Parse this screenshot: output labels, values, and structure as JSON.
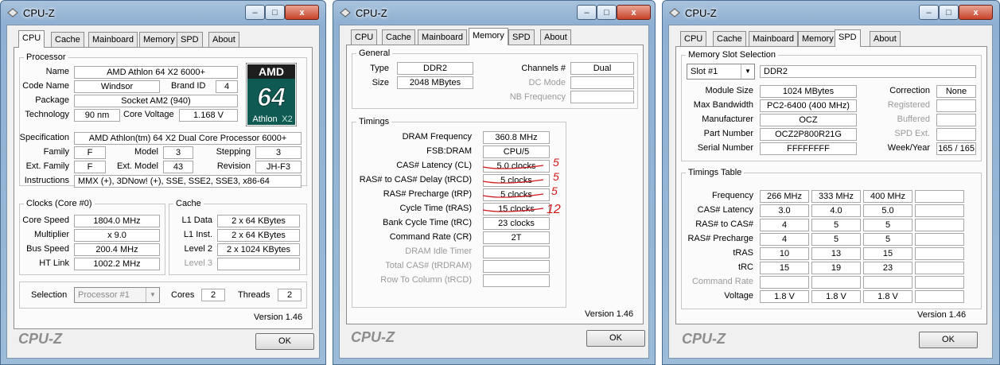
{
  "window_title": "CPU-Z",
  "version": "Version 1.46",
  "brand": "CPU-Z",
  "ok_label": "OK",
  "caption_buttons": {
    "minimize": "–",
    "maximize": "□",
    "close": "x"
  },
  "tabs": [
    "CPU",
    "Cache",
    "Mainboard",
    "Memory",
    "SPD",
    "About"
  ],
  "cpu": {
    "processor_group": "Processor",
    "name_label": "Name",
    "name": "AMD Athlon 64 X2 6000+",
    "code_name_label": "Code Name",
    "code_name": "Windsor",
    "brand_id_label": "Brand ID",
    "brand_id": "4",
    "package_label": "Package",
    "package": "Socket AM2 (940)",
    "technology_label": "Technology",
    "technology": "90 nm",
    "core_voltage_label": "Core Voltage",
    "core_voltage": "1.168 V",
    "specification_label": "Specification",
    "specification": "AMD Athlon(tm) 64 X2 Dual Core Processor 6000+",
    "family_label": "Family",
    "family": "F",
    "model_label": "Model",
    "model": "3",
    "stepping_label": "Stepping",
    "stepping": "3",
    "ext_family_label": "Ext. Family",
    "ext_family": "F",
    "ext_model_label": "Ext. Model",
    "ext_model": "43",
    "revision_label": "Revision",
    "revision": "JH-F3",
    "instructions_label": "Instructions",
    "instructions": "MMX (+), 3DNow! (+), SSE, SSE2, SSE3, x86-64",
    "logo": {
      "amd": "AMD",
      "num": "64",
      "athlon": "Athlon",
      "x2": "X2"
    },
    "clocks_group": "Clocks (Core #0)",
    "core_speed_label": "Core Speed",
    "core_speed": "1804.0 MHz",
    "multiplier_label": "Multiplier",
    "multiplier": "x 9.0",
    "bus_speed_label": "Bus Speed",
    "bus_speed": "200.4 MHz",
    "ht_link_label": "HT Link",
    "ht_link": "1002.2 MHz",
    "cache_group": "Cache",
    "l1_data_label": "L1 Data",
    "l1_data": "2 x 64 KBytes",
    "l1_inst_label": "L1 Inst.",
    "l1_inst": "2 x 64 KBytes",
    "level2_label": "Level 2",
    "level2": "2 x 1024 KBytes",
    "level3_label": "Level 3",
    "level3": "",
    "selection_label": "Selection",
    "selection": "Processor #1",
    "cores_label": "Cores",
    "cores": "2",
    "threads_label": "Threads",
    "threads": "2"
  },
  "memory": {
    "general_group": "General",
    "type_label": "Type",
    "type": "DDR2",
    "size_label": "Size",
    "size": "2048 MBytes",
    "channels_label": "Channels #",
    "channels": "Dual",
    "dc_mode_label": "DC Mode",
    "dc_mode": "",
    "nb_freq_label": "NB Frequency",
    "nb_freq": "",
    "timings_group": "Timings",
    "rows": [
      {
        "label": "DRAM Frequency",
        "value": "360.8 MHz",
        "disabled": false
      },
      {
        "label": "FSB:DRAM",
        "value": "CPU/5",
        "disabled": false
      },
      {
        "label": "CAS# Latency (CL)",
        "value": "5.0 clocks",
        "disabled": false
      },
      {
        "label": "RAS# to CAS# Delay (tRCD)",
        "value": "5 clocks",
        "disabled": false
      },
      {
        "label": "RAS# Precharge (tRP)",
        "value": "5 clocks",
        "disabled": false
      },
      {
        "label": "Cycle Time (tRAS)",
        "value": "15 clocks",
        "disabled": false
      },
      {
        "label": "Bank Cycle Time (tRC)",
        "value": "23 clocks",
        "disabled": false
      },
      {
        "label": "Command Rate (CR)",
        "value": "2T",
        "disabled": false
      },
      {
        "label": "DRAM Idle Timer",
        "value": "",
        "disabled": true
      },
      {
        "label": "Total CAS# (tRDRAM)",
        "value": "",
        "disabled": true
      },
      {
        "label": "Row To Column (tRCD)",
        "value": "",
        "disabled": true
      }
    ],
    "handwritten_notes": [
      "5",
      "5",
      "5",
      "12"
    ]
  },
  "spd": {
    "slot_group": "Memory Slot Selection",
    "slot": "Slot #1",
    "slot_type": "DDR2",
    "module_size_label": "Module Size",
    "module_size": "1024 MBytes",
    "max_bandwidth_label": "Max Bandwidth",
    "max_bandwidth": "PC2-6400 (400 MHz)",
    "manufacturer_label": "Manufacturer",
    "manufacturer": "OCZ",
    "part_number_label": "Part Number",
    "part_number": "OCZ2P800R21G",
    "serial_number_label": "Serial Number",
    "serial_number": "FFFFFFFF",
    "correction_label": "Correction",
    "correction": "None",
    "registered_label": "Registered",
    "registered": "",
    "buffered_label": "Buffered",
    "buffered": "",
    "spd_ext_label": "SPD Ext.",
    "spd_ext": "",
    "week_year_label": "Week/Year",
    "week_year": "165 / 165",
    "timings_group": "Timings Table",
    "table": [
      {
        "label": "Frequency",
        "values": [
          "266 MHz",
          "333 MHz",
          "400 MHz",
          ""
        ],
        "disabled": false
      },
      {
        "label": "CAS# Latency",
        "values": [
          "3.0",
          "4.0",
          "5.0",
          ""
        ],
        "disabled": false
      },
      {
        "label": "RAS# to CAS#",
        "values": [
          "4",
          "5",
          "5",
          ""
        ],
        "disabled": false
      },
      {
        "label": "RAS# Precharge",
        "values": [
          "4",
          "5",
          "5",
          ""
        ],
        "disabled": false
      },
      {
        "label": "tRAS",
        "values": [
          "10",
          "13",
          "15",
          ""
        ],
        "disabled": false
      },
      {
        "label": "tRC",
        "values": [
          "15",
          "19",
          "23",
          ""
        ],
        "disabled": false
      },
      {
        "label": "Command Rate",
        "values": [
          "",
          "",
          "",
          ""
        ],
        "disabled": true
      },
      {
        "label": "Voltage",
        "values": [
          "1.8 V",
          "1.8 V",
          "1.8 V",
          ""
        ],
        "disabled": false
      }
    ]
  }
}
